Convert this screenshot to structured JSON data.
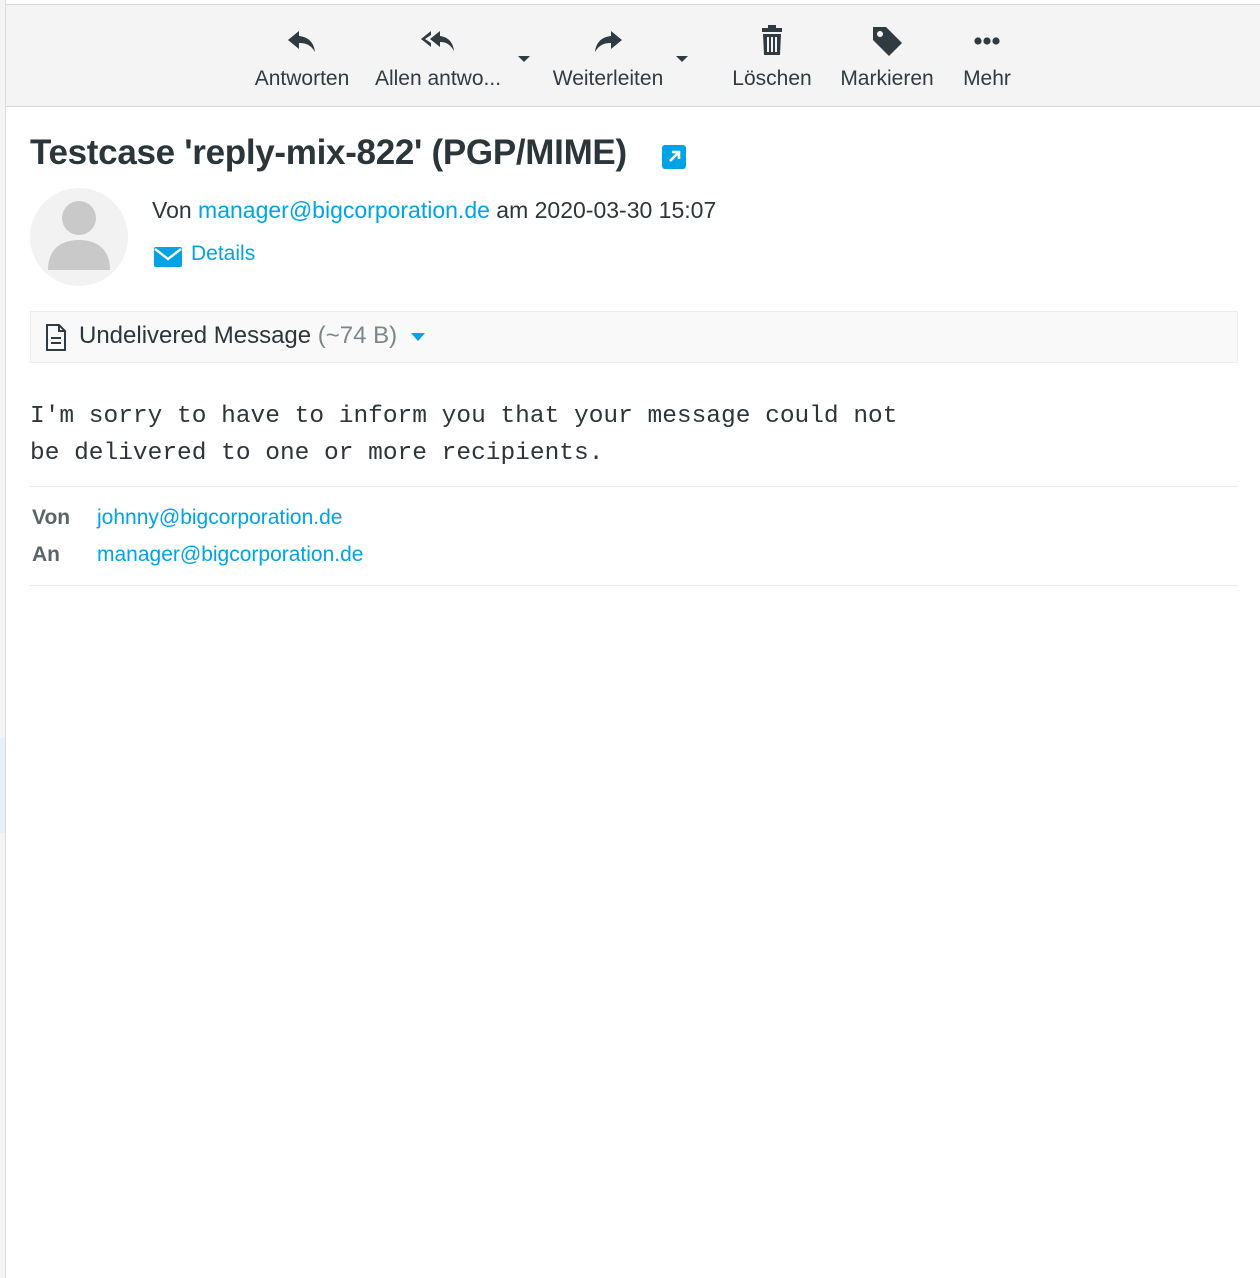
{
  "toolbar": {
    "reply": "Antworten",
    "reply_all": "Allen antwo...",
    "forward": "Weiterleiten",
    "delete": "Löschen",
    "mark": "Markieren",
    "more": "Mehr"
  },
  "message": {
    "subject": "Testcase 'reply-mix-822' (PGP/MIME)",
    "from_prefix": "Von",
    "from_address": "manager@bigcorporation.de",
    "date_prefix": "am",
    "date": "2020-03-30 15:07",
    "details_label": "Details"
  },
  "attachment": {
    "name": "Undelivered Message",
    "size": "(~74 B)"
  },
  "body": {
    "line1": "I'm sorry to have to inform you that your message could not",
    "line2": "be delivered to one or more recipients."
  },
  "embedded_headers": {
    "from_label": "Von",
    "from_value": "johnny@bigcorporation.de",
    "to_label": "An",
    "to_value": "manager@bigcorporation.de"
  },
  "colors": {
    "link": "#00a3e6",
    "text": "#2c363a",
    "toolbar_bg": "#f4f4f4"
  },
  "icons": [
    "reply-icon",
    "reply-all-icon",
    "forward-icon",
    "trash-icon",
    "tag-icon",
    "more-icon",
    "external-link-icon",
    "avatar-icon",
    "envelope-icon",
    "document-icon",
    "caret-down-icon"
  ]
}
